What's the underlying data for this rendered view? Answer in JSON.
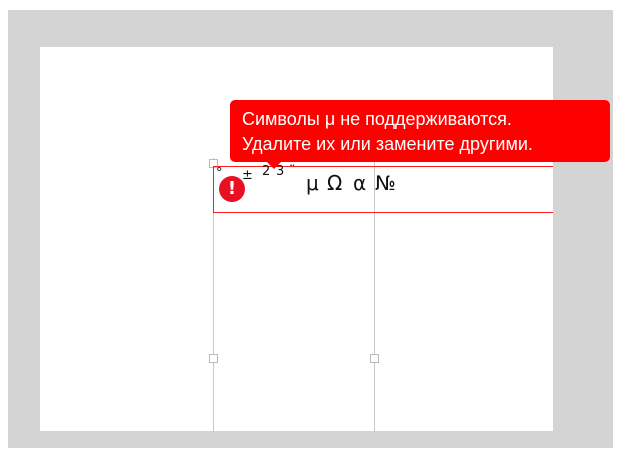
{
  "editor": {
    "field_value": "° ± ² ³ ¨ μ Ω α №",
    "symbols_small": [
      "°",
      "±",
      "2",
      "3",
      "¨"
    ],
    "symbols_large": [
      "μ",
      "Ω",
      "α",
      "№"
    ]
  },
  "error_tooltip": {
    "line1": "Символы μ не поддерживаются.",
    "line2": "Удалите их или замените другими."
  },
  "error_icon": {
    "icon": "exclamation-icon",
    "glyph": "!"
  },
  "colors": {
    "frame": "#d4d4d4",
    "canvas": "#ffffff",
    "error": "#ff0000",
    "guide": "#c9c9c9"
  }
}
